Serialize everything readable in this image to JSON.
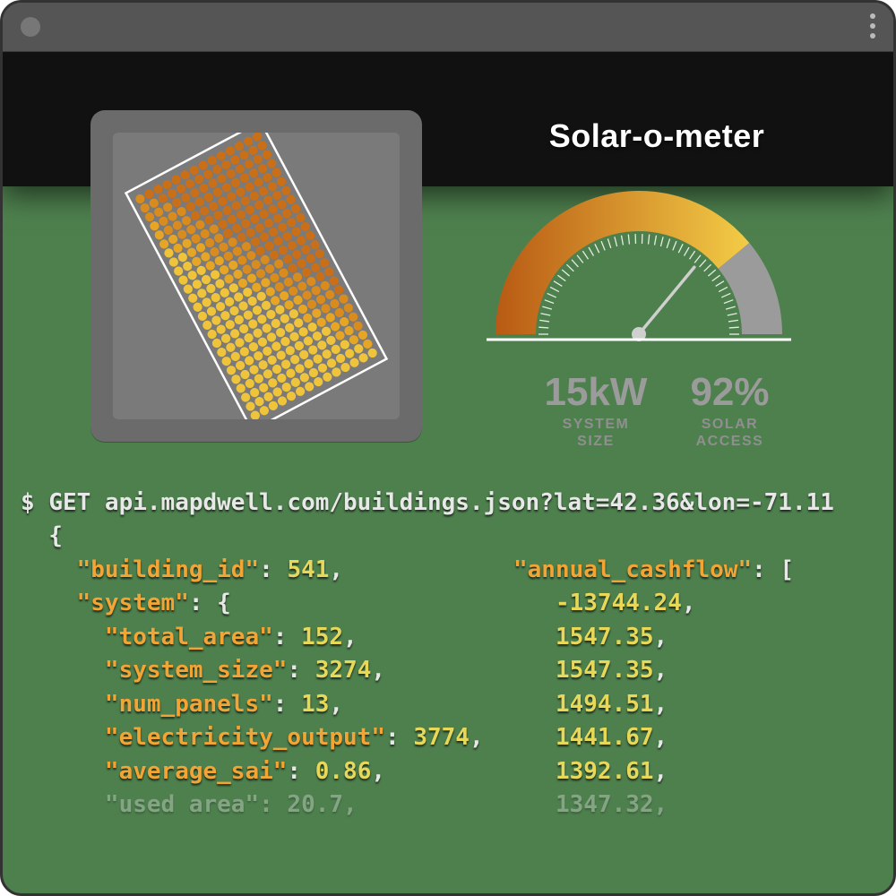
{
  "meter": {
    "title": "Solar-o-meter",
    "system_size": {
      "value": "15kW",
      "label_l1": "SYSTEM",
      "label_l2": "SIZE"
    },
    "solar_access": {
      "value": "92%",
      "label_l1": "SOLAR",
      "label_l2": "ACCESS"
    },
    "gauge_fraction": 0.78
  },
  "terminal": {
    "prompt": "$ ",
    "request": "GET api.mapdwell.com/buildings.json?lat=42.36&lon=-71.11",
    "response": {
      "building_id": 541,
      "system": {
        "total_area": 152,
        "system_size": 3274,
        "num_panels": 13,
        "electricity_output": 3774,
        "average_sai": 0.86,
        "used_area": 20.7
      },
      "annual_cashflow": [
        -13744.24,
        1547.35,
        1547.35,
        1494.51,
        1441.67,
        1392.61,
        1347.32
      ]
    }
  },
  "colors": {
    "gauge_start": "#b85a14",
    "gauge_end": "#f3cc46",
    "gauge_empty": "#9b9b9b",
    "gauge_needle": "#cfcfcf"
  }
}
